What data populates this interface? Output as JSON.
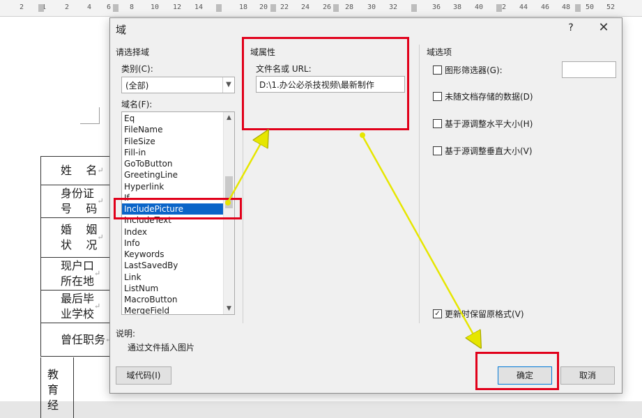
{
  "ruler": {
    "ticks": [
      "2",
      "1",
      "2",
      "4",
      "6",
      "8",
      "10",
      "12",
      "14",
      "18",
      "20",
      "22",
      "24",
      "26",
      "28",
      "30",
      "32",
      "36",
      "38",
      "40",
      "42",
      "44",
      "46",
      "48",
      "50",
      "52"
    ]
  },
  "document": {
    "rows": [
      "姓    名",
      "身份证\n号    码",
      "婚    姻\n状    况",
      "现户口\n所在地",
      "最后毕\n业学校",
      "曾任职务"
    ],
    "vertical_cell": "教\n育\n经",
    "paragraph_mark": "↵"
  },
  "dialog": {
    "title": "域",
    "help": "?",
    "close": "✕",
    "left_section": {
      "title": "请选择域",
      "category_label": "类别(C):",
      "category_value": "(全部)",
      "field_names_label": "域名(F):",
      "items": [
        "Eq",
        "FileName",
        "FileSize",
        "Fill-in",
        "GoToButton",
        "GreetingLine",
        "Hyperlink",
        "If",
        "IncludePicture",
        "IncludeText",
        "Index",
        "Info",
        "Keywords",
        "LastSavedBy",
        "Link",
        "ListNum",
        "MacroButton",
        "MergeField"
      ],
      "selected_index": 8
    },
    "middle_section": {
      "title": "域属性",
      "filename_label": "文件名或 URL:",
      "filename_value": "D:\\1.办公必杀技视频\\最新制作"
    },
    "right_section": {
      "title": "域选项",
      "options": [
        {
          "label": "图形筛选器(G):",
          "checked": false
        },
        {
          "label": "未随文档存储的数据(D)",
          "checked": false
        },
        {
          "label": "基于源调整水平大小(H)",
          "checked": false
        },
        {
          "label": "基于源调整垂直大小(V)",
          "checked": false
        }
      ],
      "preserve_format": {
        "label": "更新时保留原格式(V)",
        "checked": true
      }
    },
    "description": {
      "label": "说明:",
      "text": "通过文件插入图片"
    },
    "buttons": {
      "field_codes": "域代码(I)",
      "ok": "确定",
      "cancel": "取消"
    }
  },
  "colors": {
    "highlight": "#e1001a",
    "arrow": "#e6e600",
    "selection": "#0a64c8"
  }
}
